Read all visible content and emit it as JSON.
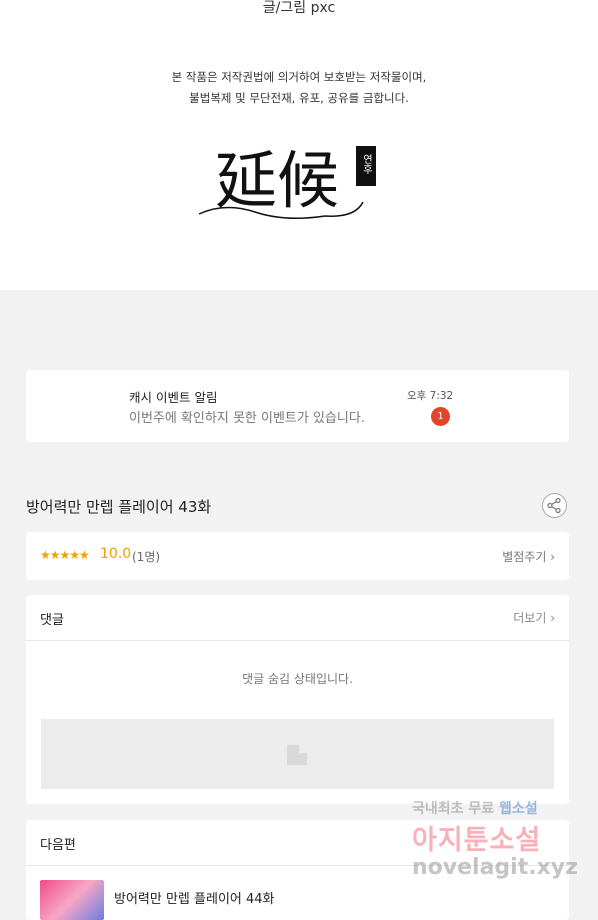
{
  "header": {
    "author": "글/그림 pxc",
    "copyright_line1": "본 작품은 저작권법에 의거하여 보호받는 저작물이며,",
    "copyright_line2": "불법복제 및 무단전재, 유포, 공유를 금합니다.",
    "logo_hanja": "延候",
    "logo_hangul": "연후"
  },
  "notification": {
    "title": "캐시 이벤트 알림",
    "message": "이번주에 확인하지 못한 이벤트가 있습니다.",
    "time": "오후 7:32",
    "badge": "1"
  },
  "episode": {
    "title": "방어력만 만렙 플레이어 43화",
    "share_icon": "share-icon"
  },
  "rating": {
    "stars": "★★★★★",
    "score": "10.0",
    "count": "(1명)",
    "rate_button": "별점주기 ›"
  },
  "comments": {
    "heading": "댓글",
    "more": "더보기 ›",
    "hidden_message": "댓글 숨김 상태입니다."
  },
  "next_episode": {
    "heading": "다음편",
    "title": "방어력만 만렙 플레이어 44화"
  },
  "watermark": {
    "line1_prefix": "국내최초 무료 ",
    "line1_highlight": "웹소설",
    "line2": "아지툰소설",
    "line3": "novelagit.xyz"
  },
  "colors": {
    "accent": "#f2a100",
    "badge": "#e2432a",
    "background": "#f2f2f2"
  }
}
